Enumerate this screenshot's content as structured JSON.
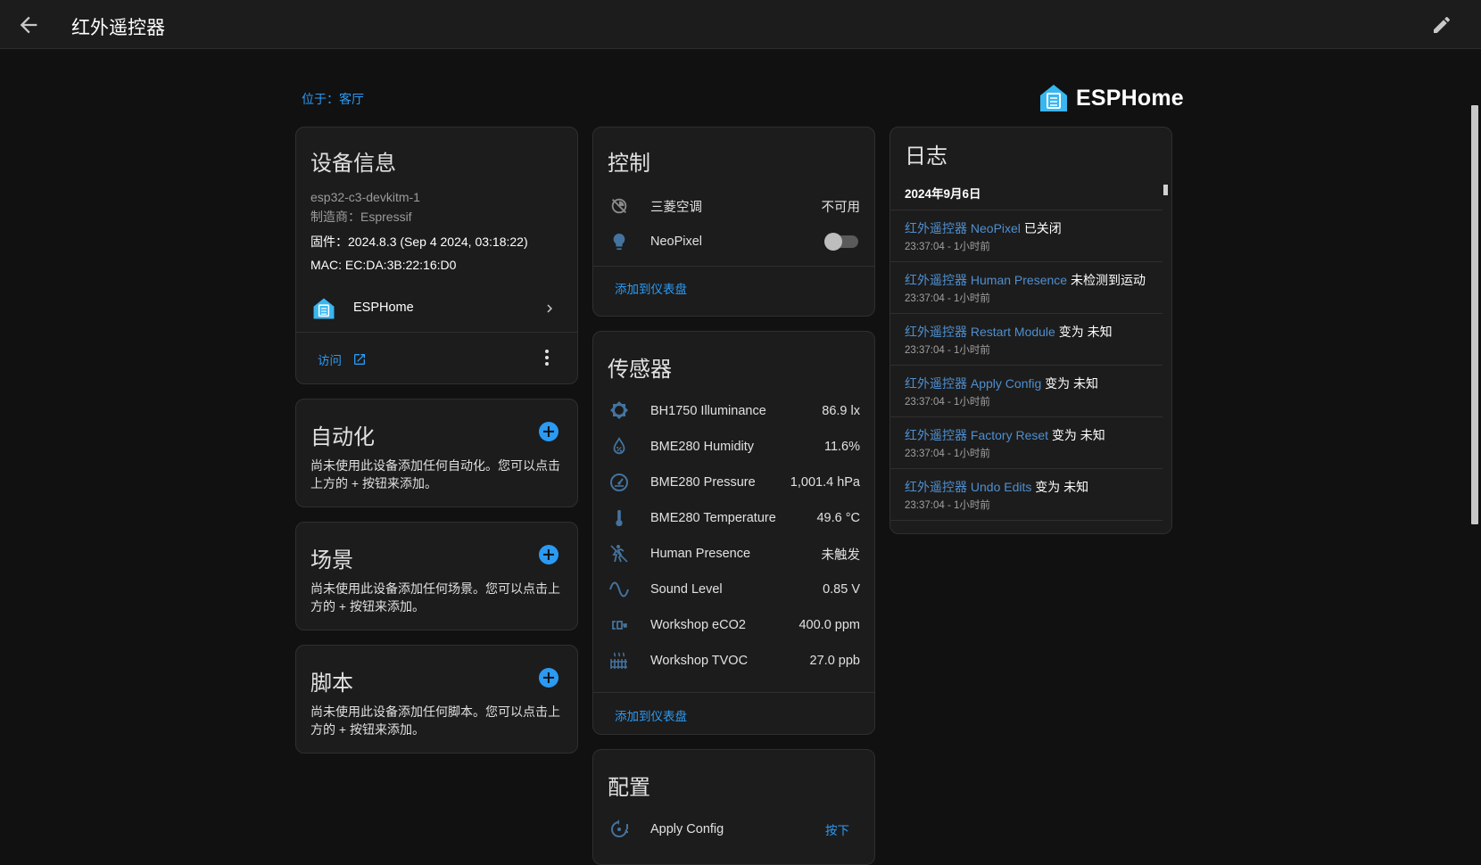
{
  "header": {
    "title": "红外遥控器"
  },
  "area_link": "位于：客厅",
  "brand": {
    "name": "ESPHome",
    "color": "#38b6f0"
  },
  "device_info": {
    "title": "设备信息",
    "model": "esp32-c3-devkitm-1",
    "manufacturer": "制造商：Espressif",
    "firmware": "固件：2024.8.3 (Sep 4 2024, 03:18:22)",
    "mac": "MAC: EC:DA:3B:22:16:D0",
    "integration": "ESPHome",
    "visit": "访问"
  },
  "automation": {
    "title": "自动化",
    "empty": "尚未使用此设备添加任何自动化。您可以点击上方的 + 按钮来添加。"
  },
  "scenes": {
    "title": "场景",
    "empty": "尚未使用此设备添加任何场景。您可以点击上方的 + 按钮来添加。"
  },
  "scripts": {
    "title": "脚本",
    "empty": "尚未使用此设备添加任何脚本。您可以点击上方的 + 按钮来添加。"
  },
  "controls": {
    "title": "控制",
    "items": [
      {
        "name": "三菱空调",
        "value": "不可用",
        "icon": "air-conditioner-off-icon"
      },
      {
        "name": "NeoPixel",
        "value": "off",
        "icon": "lightbulb-icon"
      }
    ],
    "add_to_dashboard": "添加到仪表盘"
  },
  "sensors": {
    "title": "传感器",
    "items": [
      {
        "name": "BH1750 Illuminance",
        "value": "86.9 lx",
        "icon": "brightness-icon"
      },
      {
        "name": "BME280 Humidity",
        "value": "11.6%",
        "icon": "water-percent-icon"
      },
      {
        "name": "BME280 Pressure",
        "value": "1,001.4 hPa",
        "icon": "gauge-icon"
      },
      {
        "name": "BME280 Temperature",
        "value": "49.6 °C",
        "icon": "thermometer-icon"
      },
      {
        "name": "Human Presence",
        "value": "未触发",
        "icon": "motion-sensor-icon"
      },
      {
        "name": "Sound Level",
        "value": "0.85 V",
        "icon": "sine-wave-icon"
      },
      {
        "name": "Workshop eCO2",
        "value": "400.0 ppm",
        "icon": "co2-icon"
      },
      {
        "name": "Workshop TVOC",
        "value": "27.0 ppb",
        "icon": "radiator-icon"
      }
    ],
    "add_to_dashboard": "添加到仪表盘"
  },
  "config": {
    "title": "配置",
    "items": [
      {
        "name": "Apply Config",
        "action": "按下",
        "icon": "restart-alert-icon"
      }
    ]
  },
  "logbook": {
    "title": "日志",
    "date": "2024年9月6日",
    "entries": [
      {
        "entity": "红外遥控器 NeoPixel",
        "message": "已关闭",
        "time": "23:37:04 - 1小时前"
      },
      {
        "entity": "红外遥控器 Human Presence",
        "message": "未检测到运动",
        "time": "23:37:04 - 1小时前"
      },
      {
        "entity": "红外遥控器 Restart Module",
        "message": "变为 未知",
        "time": "23:37:04 - 1小时前"
      },
      {
        "entity": "红外遥控器 Apply Config",
        "message": "变为 未知",
        "time": "23:37:04 - 1小时前"
      },
      {
        "entity": "红外遥控器 Factory Reset",
        "message": "变为 未知",
        "time": "23:37:04 - 1小时前"
      },
      {
        "entity": "红外遥控器 Undo Edits",
        "message": "变为 未知",
        "time": "23:37:04 - 1小时前"
      }
    ]
  }
}
